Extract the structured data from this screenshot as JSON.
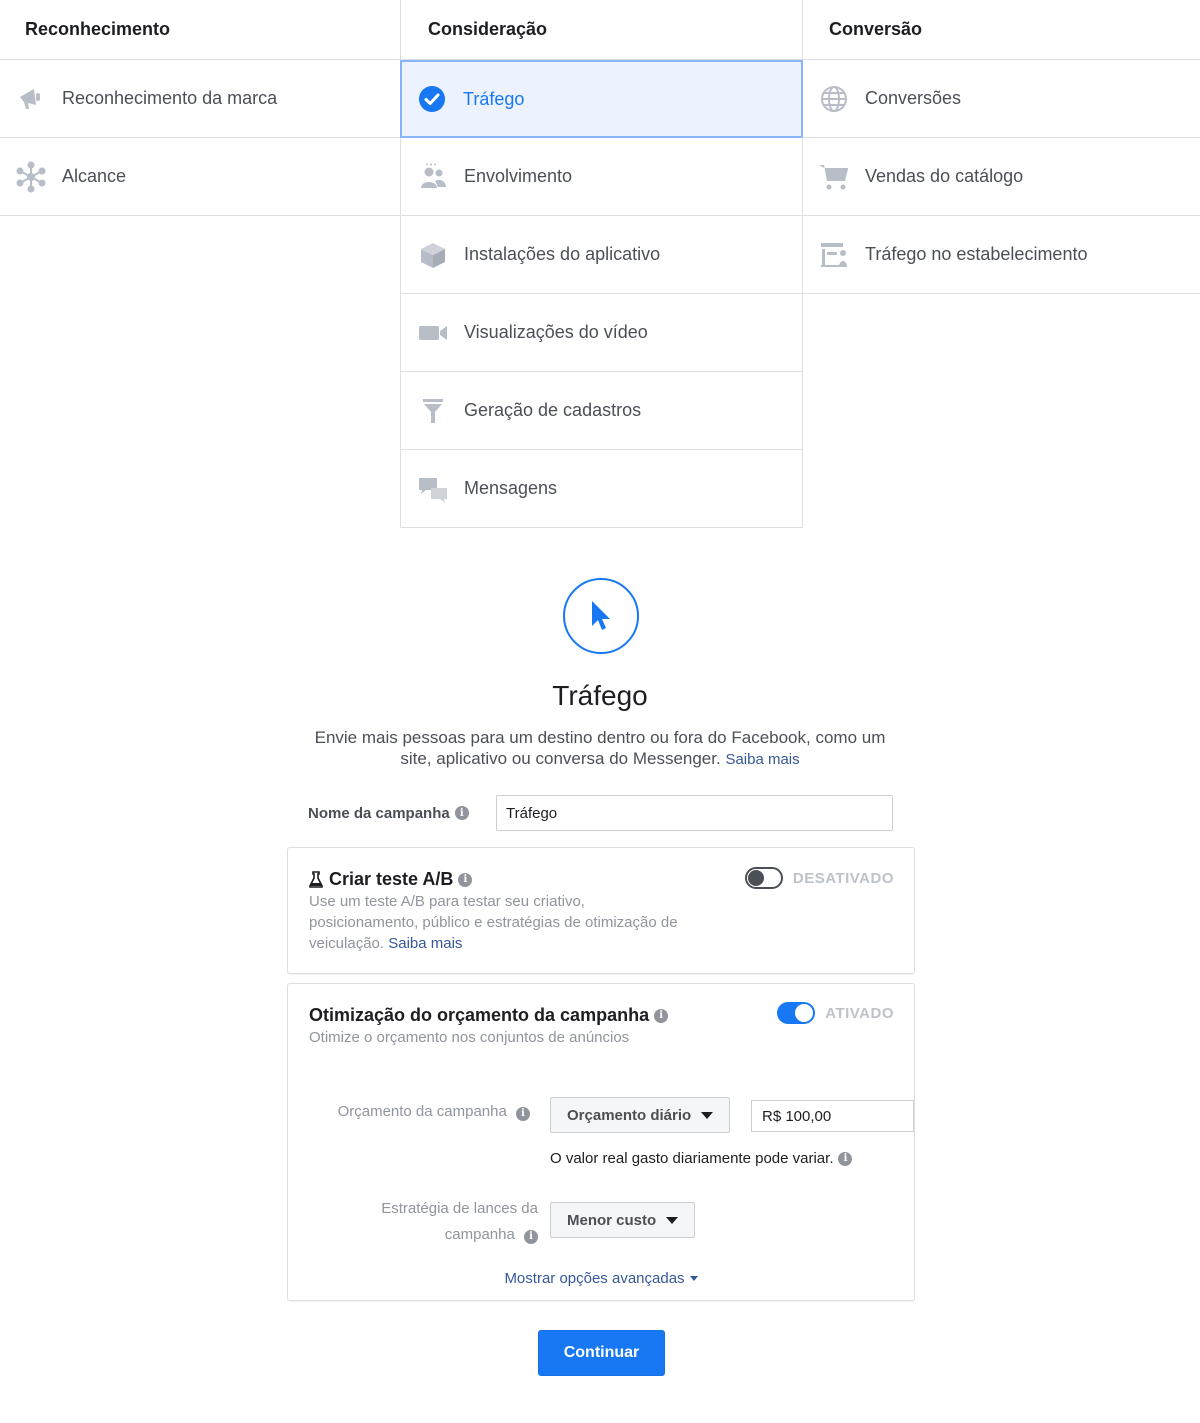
{
  "colors": {
    "accent": "#1877f2",
    "selected_bg": "#ecf3ff",
    "icon_gray": "#b8bec8"
  },
  "columns": [
    {
      "title": "Reconhecimento",
      "items": [
        {
          "label": "Reconhecimento da marca",
          "icon": "megaphone-icon"
        },
        {
          "label": "Alcance",
          "icon": "reach-icon"
        }
      ]
    },
    {
      "title": "Consideração",
      "items": [
        {
          "label": "Tráfego",
          "icon": "check-circle-icon",
          "selected": true
        },
        {
          "label": "Envolvimento",
          "icon": "people-icon"
        },
        {
          "label": "Instalações do aplicativo",
          "icon": "box-icon"
        },
        {
          "label": "Visualizações do vídeo",
          "icon": "video-camera-icon"
        },
        {
          "label": "Geração de cadastros",
          "icon": "funnel-icon"
        },
        {
          "label": "Mensagens",
          "icon": "chat-bubbles-icon"
        }
      ]
    },
    {
      "title": "Conversão",
      "items": [
        {
          "label": "Conversões",
          "icon": "globe-icon"
        },
        {
          "label": "Vendas do catálogo",
          "icon": "cart-icon"
        },
        {
          "label": "Tráfego no estabelecimento",
          "icon": "store-icon"
        }
      ]
    }
  ],
  "detail": {
    "title": "Tráfego",
    "description_line1": "Envie mais pessoas para um destino dentro ou fora do Facebook, como um",
    "description_line2": "site, aplicativo ou conversa do Messenger.",
    "learn_more": "Saiba mais",
    "campaign_name_label": "Nome da campanha",
    "campaign_name_value": "Tráfego"
  },
  "ab_test": {
    "title": "Criar teste A/B",
    "description_line1": "Use um teste A/B para testar seu criativo,",
    "description_line2": "posicionamento, público e estratégias de otimização de",
    "description_line3": "veiculação.",
    "learn_more": "Saiba mais",
    "toggle_label": "DESATIVADO",
    "enabled": false
  },
  "cbo": {
    "title": "Otimização do orçamento da campanha",
    "subtitle": "Otimize o orçamento nos conjuntos de anúncios",
    "toggle_label": "ATIVADO",
    "enabled": true,
    "budget_label": "Orçamento da campanha",
    "budget_type": "Orçamento diário",
    "budget_value": "R$ 100,00",
    "budget_note": "O valor real gasto diariamente pode variar.",
    "bid_label_line1": "Estratégia de lances da",
    "bid_label_line2": "campanha",
    "bid_strategy": "Menor custo",
    "advanced_options": "Mostrar opções avançadas"
  },
  "continue_label": "Continuar"
}
